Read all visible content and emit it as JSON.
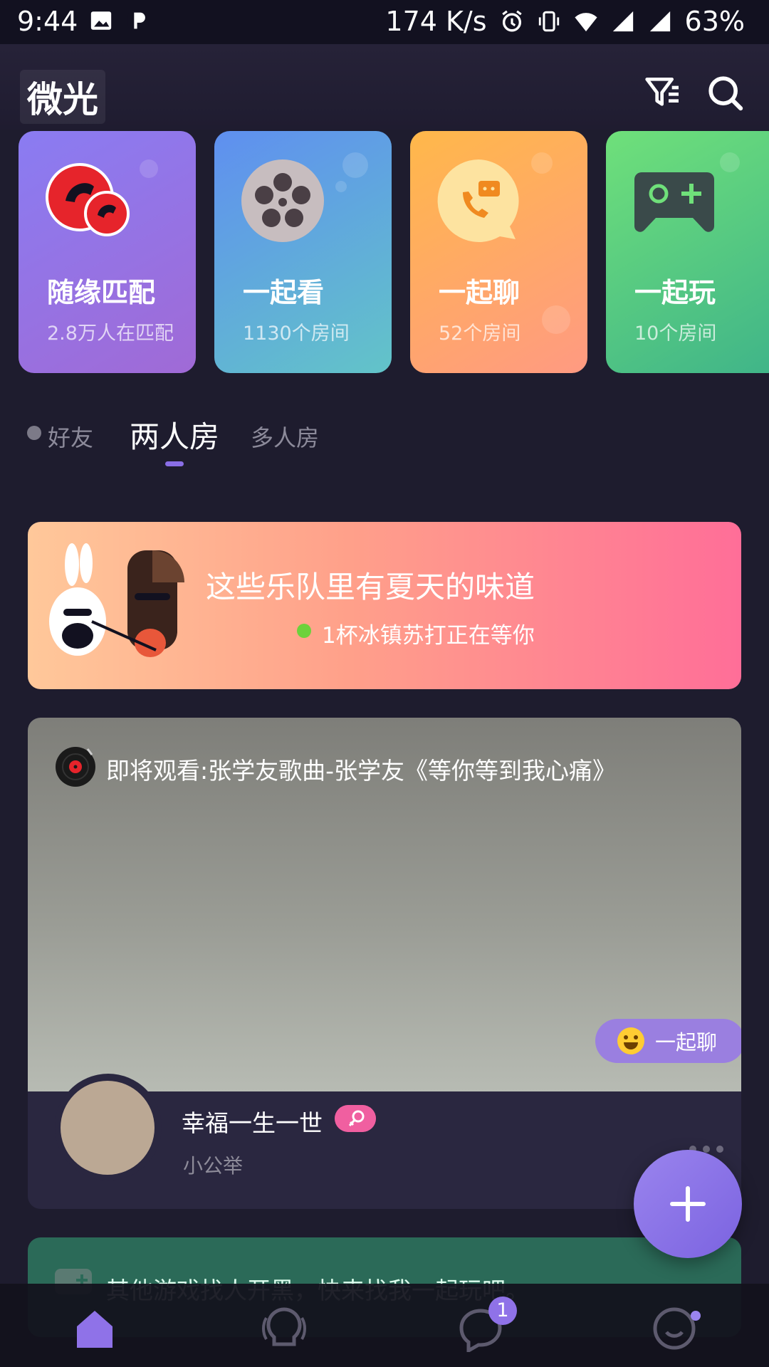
{
  "status_bar": {
    "time": "9:44",
    "net_speed": "174 K/s",
    "battery": "63%",
    "icons": [
      "image-icon",
      "p-icon",
      "alarm-icon",
      "vibrate-icon",
      "wifi-icon",
      "signal-icon",
      "signal-icon",
      "battery-icon"
    ]
  },
  "header": {
    "logo": "微光",
    "icons": [
      "filter-icon",
      "search-icon"
    ]
  },
  "categories": [
    {
      "title": "随缘匹配",
      "subtitle": "2.8万人在匹配",
      "icon": "match-avatar-icon",
      "gradient": [
        "#8a7cf2",
        "#a06ad6"
      ]
    },
    {
      "title": "一起看",
      "subtitle": "1130个房间",
      "icon": "film-reel-icon",
      "gradient": [
        "#5f8ff0",
        "#62c4c8"
      ]
    },
    {
      "title": "一起聊",
      "subtitle": "52个房间",
      "icon": "chat-phone-icon",
      "gradient": [
        "#ffb84a",
        "#ff9a82"
      ]
    },
    {
      "title": "一起玩",
      "subtitle": "10个房间",
      "icon": "gamepad-icon",
      "gradient": [
        "#6fe07a",
        "#3fb489"
      ]
    }
  ],
  "tabs": [
    {
      "label": "好友",
      "active": false
    },
    {
      "label": "两人房",
      "active": true
    },
    {
      "label": "多人房",
      "active": false
    }
  ],
  "banner": {
    "title": "这些乐队里有夏天的味道",
    "subtitle": "1杯冰镇苏打正在等你"
  },
  "room_card": {
    "now_watching": "即将观看:张学友歌曲-张学友《等你等到我心痛》",
    "chat_pill": "一起聊",
    "user_name": "幸福一生一世",
    "user_sub": "小公举"
  },
  "next_card": {
    "text": "其他游戏找人开黑，快来找我一起玩吧。"
  },
  "bottom_nav": {
    "items": [
      "home-icon",
      "bulb-icon",
      "messages-icon",
      "profile-icon"
    ],
    "message_badge": "1"
  },
  "colors": {
    "accent": "#8a6ee6",
    "background": "#1e1c2e"
  }
}
